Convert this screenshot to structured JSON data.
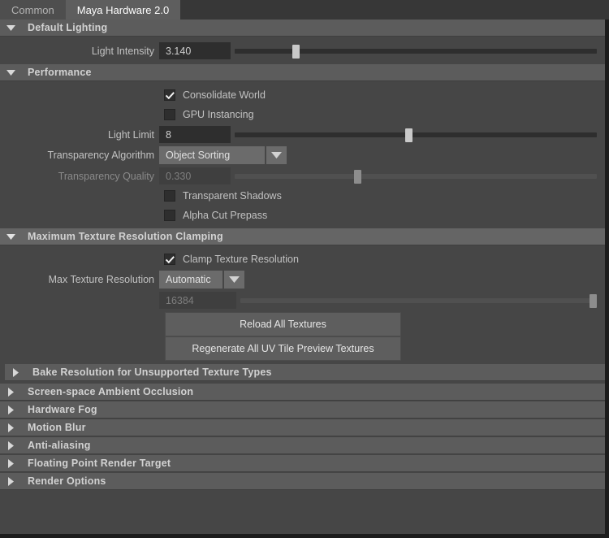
{
  "tabs": [
    {
      "label": "Common",
      "active": false
    },
    {
      "label": "Maya Hardware 2.0",
      "active": true
    }
  ],
  "sections": {
    "default_lighting": {
      "title": "Default Lighting",
      "expanded": true,
      "light_intensity": {
        "label": "Light Intensity",
        "value": "3.140",
        "slider_percent": 16
      }
    },
    "performance": {
      "title": "Performance",
      "expanded": true,
      "consolidate_world": {
        "label": "Consolidate World",
        "checked": true
      },
      "gpu_instancing": {
        "label": "GPU Instancing",
        "checked": false
      },
      "light_limit": {
        "label": "Light Limit",
        "value": "8",
        "slider_percent": 47
      },
      "transparency_algorithm": {
        "label": "Transparency Algorithm",
        "value": "Object Sorting"
      },
      "transparency_quality": {
        "label": "Transparency Quality",
        "value": "0.330",
        "slider_percent": 33,
        "disabled": true
      },
      "transparent_shadows": {
        "label": "Transparent Shadows",
        "checked": false
      },
      "alpha_cut_prepass": {
        "label": "Alpha Cut Prepass",
        "checked": false
      }
    },
    "texture_clamping": {
      "title": "Maximum Texture Resolution Clamping",
      "expanded": true,
      "clamp_texture_resolution": {
        "label": "Clamp Texture Resolution",
        "checked": true
      },
      "max_texture_resolution": {
        "label": "Max Texture Resolution",
        "value": "Automatic"
      },
      "resolution_value": {
        "value": "16384",
        "slider_percent": 100,
        "disabled": true
      },
      "reload_button": "Reload All Textures",
      "regenerate_button": "Regenerate All UV Tile Preview Textures",
      "bake_resolution": {
        "title": "Bake Resolution for Unsupported Texture Types",
        "expanded": false
      }
    }
  },
  "collapsed_sections": [
    {
      "title": "Screen-space Ambient Occlusion"
    },
    {
      "title": "Hardware Fog"
    },
    {
      "title": "Motion Blur"
    },
    {
      "title": "Anti-aliasing"
    },
    {
      "title": "Floating Point Render Target"
    },
    {
      "title": "Render Options"
    }
  ],
  "colors": {
    "panel_bg": "#464646",
    "header_bg": "#5c5c5c",
    "field_bg": "#2e2e2e",
    "active_tab": "#5e5e5e",
    "inactive_tab": "#4e4e4e",
    "text": "#c2c2c2"
  }
}
